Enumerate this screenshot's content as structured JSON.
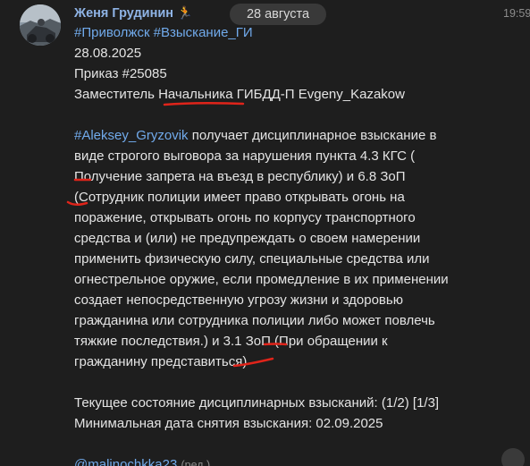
{
  "message": {
    "sender_name": "Женя Грудинин",
    "sender_emoji": "🏃",
    "date_pill": "28 августа",
    "time": "19:59",
    "tags": "#Приволжск #Взыскание_ГИ",
    "date_line": "28.08.2025",
    "order_line": "Приказ #25085",
    "deputy_line": "Заместитель Начальника ГИБДД-П Evgeny_Kazakow",
    "subject_mention": "#Aleksey_Gryzovik",
    "body_lines": [
      " получает дисциплинарное взыскание в",
      "виде строгого выговора за нарушения пункта 4.3 КГС (",
      "Получение запрета на въезд в республику) и 6.8 ЗоП",
      "(Сотрудник полиции имеет право открывать огонь на",
      "поражение, открывать огонь по корпусу транспортного",
      "средства и (или) не предупреждать о своем намерении",
      "применить физическую силу, специальные средства или",
      "огнестрельное оружие, если промедление в их применении",
      "создает непосредственную угрозу жизни и здоровью",
      "гражданина или сотрудника полиции либо может повлечь",
      "тяжкие последствия.) и 3.1 ЗоП (При обращении к",
      "гражданину представиться)"
    ],
    "status_line": "Текущее состояние дисциплинарных взысканий: (1/2) [1/3]",
    "min_date_line": "Минимальная дата снятия взыскания: 02.09.2025",
    "author_mention": "@malinochkka23",
    "edited_label": "(ред.)"
  },
  "colors": {
    "background": "#1e1e1e",
    "text": "#e4e4e4",
    "link": "#71aaeb",
    "sender": "#8fb4e6",
    "annotation": "#e0241a"
  }
}
